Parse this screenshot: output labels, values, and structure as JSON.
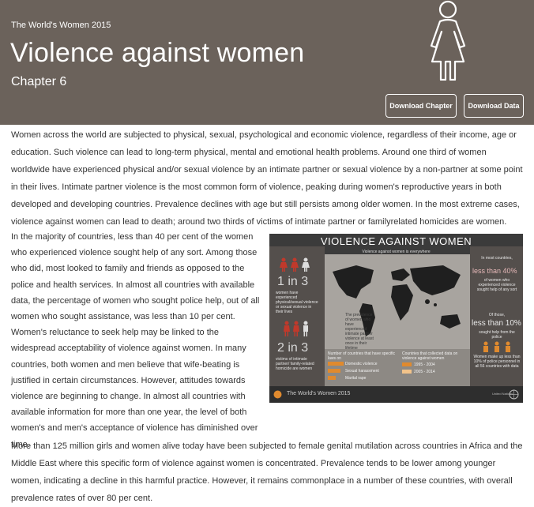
{
  "header": {
    "series": "The World's Women 2015",
    "title": "Violence against women",
    "chapter": "Chapter 6",
    "download_chapter": "Download Chapter",
    "download_data": "Download Data"
  },
  "body": {
    "intro": "Women across the world are subjected to physical, sexual, psychological and economic violence, regardless of their income, age or education. Such violence can lead to long-term physical, mental and emotional health problems. Around one third of women worldwide have experienced physical and/or sexual violence by an intimate partner or sexual violence by a non-partner at some point in their lives. Intimate partner violence is the most common form of violence, peaking during women's reproductive years in both developed and developing countries. Prevalence declines with age but still persists among older women. In the most extreme cases, violence against women can lead to death; around two thirds of victims of intimate partner or familyrelated homicides are women.",
    "left_paragraph": "In the majority of countries, less than 40 per cent of the women who experienced violence sought help of any sort. Among those who did, most looked to family and friends as opposed to the police and health services. In almost all countries with available data, the percentage of women who sought police help, out of all women who sought assistance, was less than 10 per cent. Women's reluctance to seek help may be linked to the widespread acceptability of violence against women. In many countries, both women and men believe that wife-beating is justified in certain circumstances. However, attitudes towards violence are beginning to change. In almost all countries with available information for more than one year, the level of both women's and men's acceptance of violence has diminished over time.",
    "bottom_paragraph": "More than 125 million girls and women alive today have been subjected to female genital mutilation across countries in Africa and the Middle East where this specific form of violence against women is concentrated. Prevalence tends to be lower among younger women, indicating a decline in this harmful practice. However, it remains commonplace in a number of these countries, with overall prevalence rates of over 80 per cent."
  },
  "infographic": {
    "title": "VIOLENCE AGAINST WOMEN",
    "subtitle": "Violence against women is everywhere",
    "stat1": "1 in 3",
    "stat1_text": "women have experienced physical/sexual violence or sexual violence in their lives",
    "stat2": "2 in 3",
    "stat2_text": "victims of intimate partner/ family-related homicide are women",
    "map_note": "The prevalence of women who have experienced intimate partner violence at least once in their lifetime",
    "legend_left_title": "Number of countries that have specific laws on",
    "legend_left_1": "Domestic violence",
    "legend_left_2": "Sexual harassment",
    "legend_left_3": "Marital rape",
    "legend_right_title": "Countries that collected data on violence against women",
    "legend_right_1": "1995 - 2004",
    "legend_right_2": "2005 - 2014",
    "right_intro": "In most countries,",
    "right_stat1": "less than 40%",
    "right_stat1_text": "of women who experienced violence sought help of any sort",
    "right_among": "Of those,",
    "right_stat2": "less than 10%",
    "right_stat2_text": "sought help from the police",
    "right_bottom_text": "Women make up less than 10% of police personnel in all 56 countries with data",
    "footer": "The World's Women 2015",
    "footer_un": "United Nations",
    "colors": {
      "background": "#3b3b3b",
      "panel": "#544f4c",
      "map_bg": "#a8a49f",
      "accent_red": "#c0392b",
      "accent_orange": "#e08a2e"
    }
  }
}
